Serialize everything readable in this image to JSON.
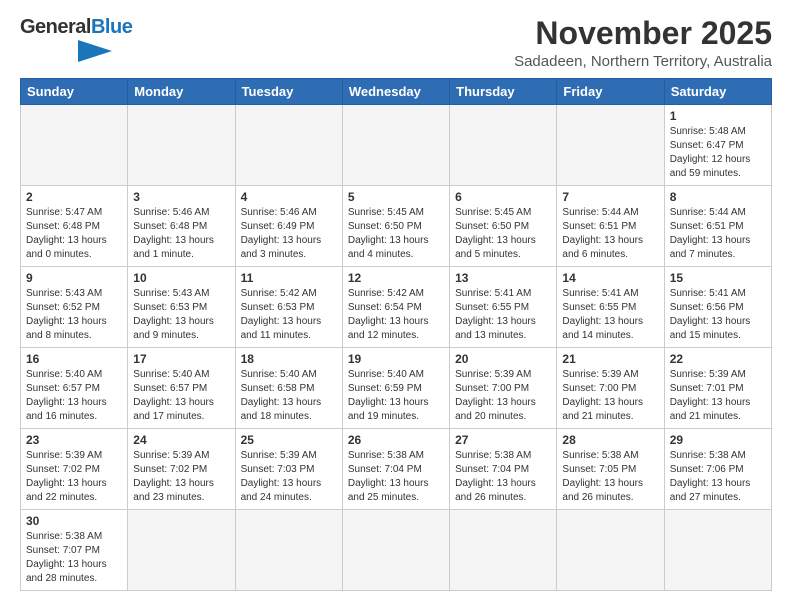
{
  "header": {
    "logo_general": "General",
    "logo_blue": "Blue",
    "month_title": "November 2025",
    "location": "Sadadeen, Northern Territory, Australia"
  },
  "days_of_week": [
    "Sunday",
    "Monday",
    "Tuesday",
    "Wednesday",
    "Thursday",
    "Friday",
    "Saturday"
  ],
  "weeks": [
    [
      {
        "day": "",
        "info": ""
      },
      {
        "day": "",
        "info": ""
      },
      {
        "day": "",
        "info": ""
      },
      {
        "day": "",
        "info": ""
      },
      {
        "day": "",
        "info": ""
      },
      {
        "day": "",
        "info": ""
      },
      {
        "day": "1",
        "info": "Sunrise: 5:48 AM\nSunset: 6:47 PM\nDaylight: 12 hours and 59 minutes."
      }
    ],
    [
      {
        "day": "2",
        "info": "Sunrise: 5:47 AM\nSunset: 6:48 PM\nDaylight: 13 hours and 0 minutes."
      },
      {
        "day": "3",
        "info": "Sunrise: 5:46 AM\nSunset: 6:48 PM\nDaylight: 13 hours and 1 minute."
      },
      {
        "day": "4",
        "info": "Sunrise: 5:46 AM\nSunset: 6:49 PM\nDaylight: 13 hours and 3 minutes."
      },
      {
        "day": "5",
        "info": "Sunrise: 5:45 AM\nSunset: 6:50 PM\nDaylight: 13 hours and 4 minutes."
      },
      {
        "day": "6",
        "info": "Sunrise: 5:45 AM\nSunset: 6:50 PM\nDaylight: 13 hours and 5 minutes."
      },
      {
        "day": "7",
        "info": "Sunrise: 5:44 AM\nSunset: 6:51 PM\nDaylight: 13 hours and 6 minutes."
      },
      {
        "day": "8",
        "info": "Sunrise: 5:44 AM\nSunset: 6:51 PM\nDaylight: 13 hours and 7 minutes."
      }
    ],
    [
      {
        "day": "9",
        "info": "Sunrise: 5:43 AM\nSunset: 6:52 PM\nDaylight: 13 hours and 8 minutes."
      },
      {
        "day": "10",
        "info": "Sunrise: 5:43 AM\nSunset: 6:53 PM\nDaylight: 13 hours and 9 minutes."
      },
      {
        "day": "11",
        "info": "Sunrise: 5:42 AM\nSunset: 6:53 PM\nDaylight: 13 hours and 11 minutes."
      },
      {
        "day": "12",
        "info": "Sunrise: 5:42 AM\nSunset: 6:54 PM\nDaylight: 13 hours and 12 minutes."
      },
      {
        "day": "13",
        "info": "Sunrise: 5:41 AM\nSunset: 6:55 PM\nDaylight: 13 hours and 13 minutes."
      },
      {
        "day": "14",
        "info": "Sunrise: 5:41 AM\nSunset: 6:55 PM\nDaylight: 13 hours and 14 minutes."
      },
      {
        "day": "15",
        "info": "Sunrise: 5:41 AM\nSunset: 6:56 PM\nDaylight: 13 hours and 15 minutes."
      }
    ],
    [
      {
        "day": "16",
        "info": "Sunrise: 5:40 AM\nSunset: 6:57 PM\nDaylight: 13 hours and 16 minutes."
      },
      {
        "day": "17",
        "info": "Sunrise: 5:40 AM\nSunset: 6:57 PM\nDaylight: 13 hours and 17 minutes."
      },
      {
        "day": "18",
        "info": "Sunrise: 5:40 AM\nSunset: 6:58 PM\nDaylight: 13 hours and 18 minutes."
      },
      {
        "day": "19",
        "info": "Sunrise: 5:40 AM\nSunset: 6:59 PM\nDaylight: 13 hours and 19 minutes."
      },
      {
        "day": "20",
        "info": "Sunrise: 5:39 AM\nSunset: 7:00 PM\nDaylight: 13 hours and 20 minutes."
      },
      {
        "day": "21",
        "info": "Sunrise: 5:39 AM\nSunset: 7:00 PM\nDaylight: 13 hours and 21 minutes."
      },
      {
        "day": "22",
        "info": "Sunrise: 5:39 AM\nSunset: 7:01 PM\nDaylight: 13 hours and 21 minutes."
      }
    ],
    [
      {
        "day": "23",
        "info": "Sunrise: 5:39 AM\nSunset: 7:02 PM\nDaylight: 13 hours and 22 minutes."
      },
      {
        "day": "24",
        "info": "Sunrise: 5:39 AM\nSunset: 7:02 PM\nDaylight: 13 hours and 23 minutes."
      },
      {
        "day": "25",
        "info": "Sunrise: 5:39 AM\nSunset: 7:03 PM\nDaylight: 13 hours and 24 minutes."
      },
      {
        "day": "26",
        "info": "Sunrise: 5:38 AM\nSunset: 7:04 PM\nDaylight: 13 hours and 25 minutes."
      },
      {
        "day": "27",
        "info": "Sunrise: 5:38 AM\nSunset: 7:04 PM\nDaylight: 13 hours and 26 minutes."
      },
      {
        "day": "28",
        "info": "Sunrise: 5:38 AM\nSunset: 7:05 PM\nDaylight: 13 hours and 26 minutes."
      },
      {
        "day": "29",
        "info": "Sunrise: 5:38 AM\nSunset: 7:06 PM\nDaylight: 13 hours and 27 minutes."
      }
    ],
    [
      {
        "day": "30",
        "info": "Sunrise: 5:38 AM\nSunset: 7:07 PM\nDaylight: 13 hours and 28 minutes."
      },
      {
        "day": "",
        "info": ""
      },
      {
        "day": "",
        "info": ""
      },
      {
        "day": "",
        "info": ""
      },
      {
        "day": "",
        "info": ""
      },
      {
        "day": "",
        "info": ""
      },
      {
        "day": "",
        "info": ""
      }
    ]
  ]
}
